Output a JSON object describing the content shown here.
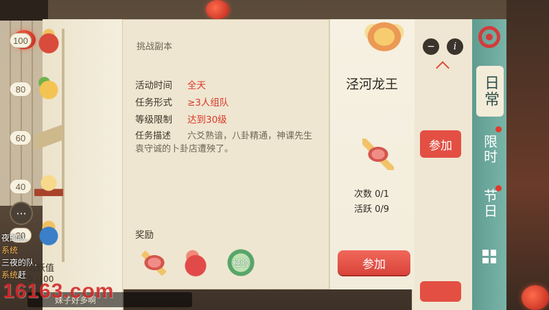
{
  "track": {
    "milestones": [
      {
        "value": "100",
        "icon": "pouch-icon"
      },
      {
        "value": "80",
        "icon": "fruit-icon"
      },
      {
        "value": "60",
        "icon": "scroll-icon"
      },
      {
        "value": "40",
        "icon": "orb-icon"
      },
      {
        "value": "20",
        "icon": "pot-icon"
      }
    ],
    "label": "活跃值",
    "progress": "0 /100"
  },
  "chat": {
    "lines": [
      {
        "text": "夜的队,"
      },
      {
        "tag": "系统",
        "text": ""
      },
      {
        "text": "三夜的队,"
      },
      {
        "tag": "系统",
        "text": "赶"
      }
    ],
    "input_text": "妹子好多啊"
  },
  "watermark": "16163.com",
  "popup": {
    "title": "挑战副本",
    "rows": [
      {
        "label": "活动时间",
        "value": "全天"
      },
      {
        "label": "任务形式",
        "value": "≥3人组队"
      },
      {
        "label": "等级限制",
        "value": "达到30级"
      }
    ],
    "desc_label": "任务描述",
    "desc_text": "六爻熟谙，八卦精通，神课先生袁守诚的卜卦店遭殃了。",
    "reward_label": "奖励",
    "rewards": [
      {
        "icon": "crystal-icon"
      },
      {
        "icon": "flame-stone-icon"
      },
      {
        "icon": "exp-icon",
        "text": "经验"
      }
    ]
  },
  "boss": {
    "name": "泾河龙王",
    "count_label": "次数",
    "count_value": "0/1",
    "activity_label": "活跃",
    "activity_value": "0/9",
    "join_label": "参加"
  },
  "back_panel": {
    "join_label": "参加"
  },
  "sidetabs": {
    "daily": "日常",
    "limited": "限时",
    "festival": "节日"
  },
  "colors": {
    "accent_red": "#d9392b",
    "button_red": "#e34f43",
    "panel_bg": "#efe6d1",
    "side_teal": "#5f9c90"
  }
}
